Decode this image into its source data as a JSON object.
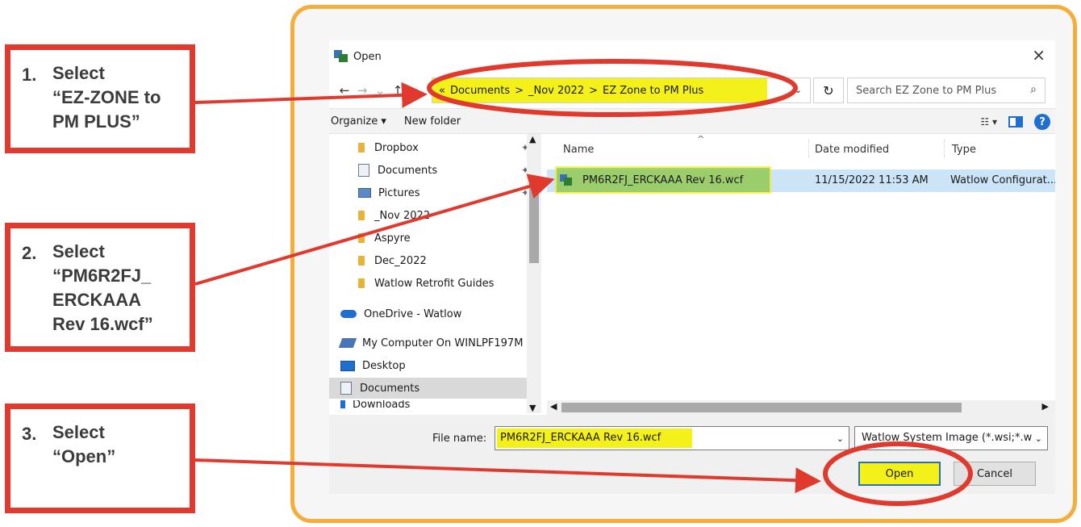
{
  "steps": [
    {
      "num": "1.",
      "lines": [
        "Select",
        "“EZ-ZONE to",
        "PM PLUS”"
      ]
    },
    {
      "num": "2.",
      "lines": [
        "Select",
        "“PM6R2FJ_",
        "ERCKAAA",
        "Rev 16.wcf”"
      ]
    },
    {
      "num": "3.",
      "lines": [
        "Select",
        "“Open”"
      ]
    }
  ],
  "dialog": {
    "title": "Open",
    "close": "×",
    "nav": {
      "back": "←",
      "forward": "→",
      "recent": "⌄",
      "up": "↑"
    },
    "breadcrumb": [
      "«",
      "Documents",
      ">",
      "_Nov 2022",
      ">",
      "EZ Zone to PM Plus"
    ],
    "refresh": "↻",
    "search_placeholder": "Search EZ Zone to PM Plus",
    "toolbar": {
      "organize": "Organize ▾",
      "new_folder": "New folder",
      "help": "?"
    },
    "nav_items": [
      {
        "label": "Dropbox",
        "icon": "folder-icon"
      },
      {
        "label": "Documents",
        "icon": "document-icon"
      },
      {
        "label": "Pictures",
        "icon": "pictures-icon"
      },
      {
        "label": "_Nov 2022",
        "icon": "folder-icon"
      },
      {
        "label": "Aspyre",
        "icon": "folder-icon"
      },
      {
        "label": "Dec_2022",
        "icon": "folder-icon"
      },
      {
        "label": "Watlow Retrofit Guides",
        "icon": "folder-icon"
      },
      {
        "label": "OneDrive - Watlow",
        "icon": "cloud-icon"
      },
      {
        "label": "My Computer On WINLPF197M",
        "icon": "computer-icon"
      },
      {
        "label": "Desktop",
        "icon": "desktop-icon"
      },
      {
        "label": "Documents",
        "icon": "document-icon"
      },
      {
        "label": "Downloads",
        "icon": "download-icon"
      }
    ],
    "columns": {
      "name": "Name",
      "date": "Date modified",
      "type": "Type"
    },
    "files": [
      {
        "name": "PM6R2FJ_ERCKAAA Rev 16.wcf",
        "date": "11/15/2022 11:53 AM",
        "type": "Watlow Configurat..."
      }
    ],
    "file_name_label": "File name:",
    "file_name_value": "PM6R2FJ_ERCKAAA Rev 16.wcf",
    "filter": "Watlow System Image (*.wsi;*.w",
    "open_label": "Open",
    "cancel_label": "Cancel"
  },
  "colors": {
    "callout_red": "#e03a2f",
    "frame_orange": "#f5ae3a",
    "highlight_yellow": "#f4f01a"
  }
}
